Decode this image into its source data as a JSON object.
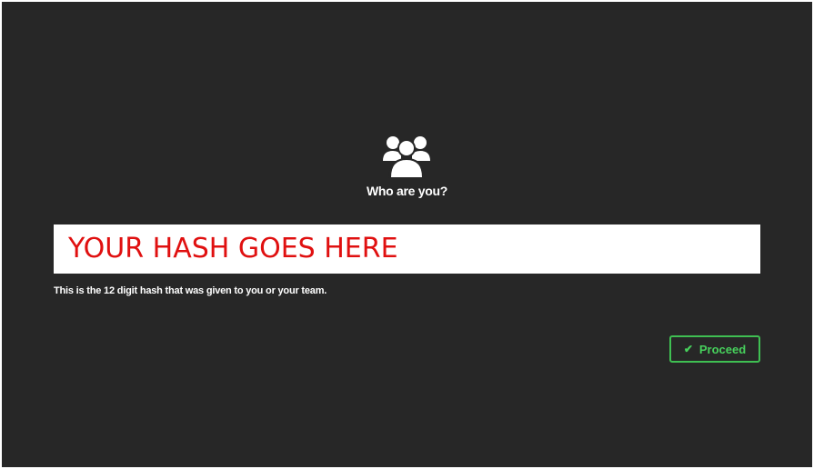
{
  "header": {
    "icon": "users-group-icon",
    "title": "Who are you?"
  },
  "hash_field": {
    "value": "YOUR HASH GOES HERE",
    "hint": "This is the 12 digit hash that was given to you or your team."
  },
  "actions": {
    "proceed_icon": "checkmark-icon",
    "proceed_label": "Proceed"
  },
  "colors": {
    "background": "#272727",
    "hash_text": "#e01010",
    "accent": "#47d15c"
  }
}
